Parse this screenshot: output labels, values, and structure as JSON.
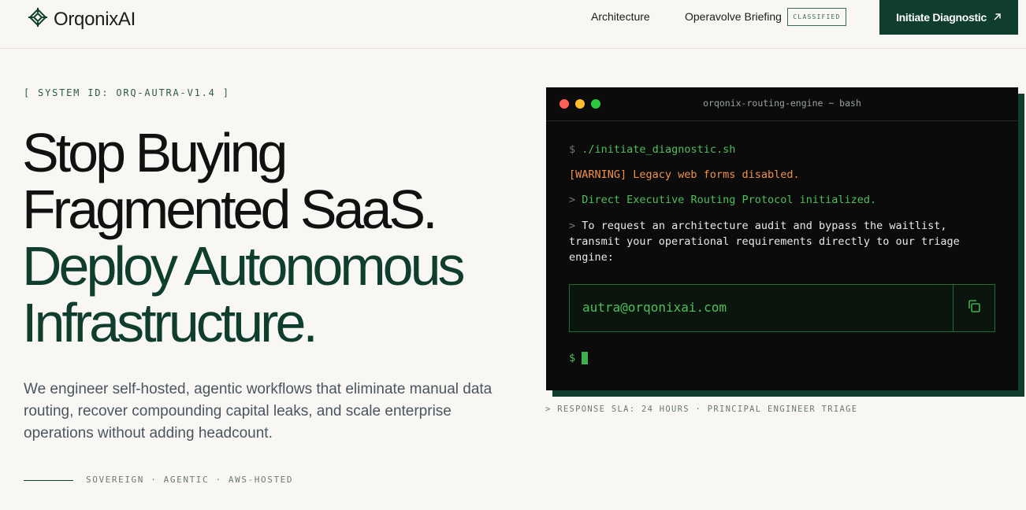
{
  "header": {
    "brand": "OrqonixAI",
    "nav": {
      "architecture": "Architecture",
      "briefing": "Operavolve Briefing",
      "classified_badge": "CLASSIFIED"
    },
    "cta_label": "Initiate Diagnostic",
    "cta_icon": "arrow-up-right-icon"
  },
  "hero": {
    "system_id": "[ SYSTEM ID: ORQ-AUTRA-V1.4 ]",
    "headline_line1": "Stop Buying",
    "headline_line2": "Fragmented SaaS.",
    "headline_line3": "Deploy Autonomous",
    "headline_line4": "Infrastructure.",
    "subtext": "We engineer self-hosted, agentic workflows that eliminate manual data routing, recover compounding capital leaks, and scale enterprise operations without adding headcount.",
    "tagline": "SOVEREIGN · AGENTIC · AWS-HOSTED"
  },
  "terminal": {
    "title": "orqonix-routing-engine ~ bash",
    "prompt_symbol": "$",
    "command": "./initiate_diagnostic.sh",
    "warning": "[WARNING] Legacy web forms disabled.",
    "status_marker": ">",
    "status": "Direct Executive Routing Protocol initialized.",
    "instruction": "To request an architecture audit and bypass the waitlist, transmit your operational requirements directly to our triage engine:",
    "email": "autra@orqonixai.com",
    "copy_icon": "copy-icon",
    "final_prompt": "$"
  },
  "sla": "> RESPONSE SLA: 24 HOURS · PRINCIPAL ENGINEER TRIAGE",
  "colors": {
    "background": "#f8f7f3",
    "brand_green": "#0f3d2e",
    "terminal_bg": "#0b0b0b",
    "terminal_green": "#4fbf5a",
    "warning_orange": "#f0914a"
  }
}
